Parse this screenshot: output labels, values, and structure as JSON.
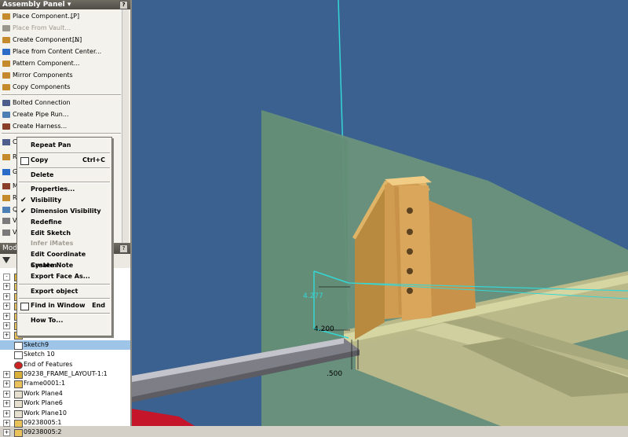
{
  "assembly_panel": {
    "title": "Assembly Panel ▾",
    "help": "?",
    "tools": [
      {
        "label": "Place Component...",
        "shortcut": "[P]",
        "icon": "place-component-icon",
        "enabled": true
      },
      {
        "label": "Place From Vault...",
        "shortcut": "",
        "icon": "place-from-vault-icon",
        "enabled": false
      },
      {
        "label": "Create Component...",
        "shortcut": "[N]",
        "icon": "create-component-icon",
        "enabled": true
      },
      {
        "label": "Place from Content Center...",
        "shortcut": "",
        "icon": "content-center-icon",
        "enabled": true
      },
      {
        "label": "Pattern Component...",
        "shortcut": "",
        "icon": "pattern-component-icon",
        "enabled": true
      },
      {
        "label": "Mirror Components",
        "shortcut": "",
        "icon": "mirror-components-icon",
        "enabled": true
      },
      {
        "label": "Copy Components",
        "shortcut": "",
        "icon": "copy-components-icon",
        "enabled": true
      },
      {
        "label": "Bolted Connection",
        "shortcut": "",
        "icon": "bolted-connection-icon",
        "enabled": true
      },
      {
        "label": "Create Pipe Run...",
        "shortcut": "",
        "icon": "pipe-run-icon",
        "enabled": true
      },
      {
        "label": "Create Harness...",
        "shortcut": "",
        "icon": "harness-icon",
        "enabled": true
      }
    ],
    "partial_items": [
      "C",
      "R",
      "G",
      "M",
      "R",
      "Q",
      "V",
      "V"
    ]
  },
  "model_browser": {
    "title": "Mod",
    "help": "?",
    "rows": [
      {
        "label": "",
        "icon": "assembly-icon",
        "expand": "-"
      },
      {
        "label": "",
        "icon": "folder-icon",
        "expand": "+"
      },
      {
        "label": "",
        "icon": "part-icon",
        "expand": "+"
      },
      {
        "label": "",
        "icon": "part-icon",
        "expand": "+"
      },
      {
        "label": "",
        "icon": "part-icon",
        "expand": "+"
      },
      {
        "label": "",
        "icon": "part-icon",
        "expand": "+"
      },
      {
        "label": "",
        "icon": "part-icon",
        "expand": "+"
      },
      {
        "label": "Sketch9",
        "icon": "sketch-icon",
        "expand": ""
      },
      {
        "label": "Sketch 10",
        "icon": "sketch-icon",
        "expand": ""
      },
      {
        "label": "End of Features",
        "icon": "end-of-features-icon",
        "expand": ""
      },
      {
        "label": "09238_FRAME_LAYOUT-1:1",
        "icon": "assembly-icon",
        "expand": "+"
      },
      {
        "label": "Frame0001:1",
        "icon": "part-icon",
        "expand": "+"
      },
      {
        "label": "Work Plane4",
        "icon": "work-plane-icon",
        "expand": "+"
      },
      {
        "label": "Work Plane6",
        "icon": "work-plane-icon",
        "expand": "+"
      },
      {
        "label": "Work Plane10",
        "icon": "work-plane-icon",
        "expand": "+"
      },
      {
        "label": "09238005:1",
        "icon": "part-icon",
        "expand": "+"
      },
      {
        "label": "09238005:2",
        "icon": "part-icon",
        "expand": "+"
      }
    ]
  },
  "context_menu": {
    "items": [
      {
        "label": "Repeat Pan",
        "shortcut": "",
        "checked": false,
        "icon": "",
        "enabled": true
      },
      {
        "sep": true
      },
      {
        "label": "Copy",
        "shortcut": "Ctrl+C",
        "checked": false,
        "icon": "copy-icon",
        "enabled": true
      },
      {
        "sep": true
      },
      {
        "label": "Delete",
        "shortcut": "",
        "checked": false,
        "icon": "",
        "enabled": true
      },
      {
        "sep": true
      },
      {
        "label": "Properties...",
        "shortcut": "",
        "checked": false,
        "icon": "",
        "enabled": true
      },
      {
        "label": "Visibility",
        "shortcut": "",
        "checked": true,
        "icon": "",
        "enabled": true
      },
      {
        "label": "Dimension Visibility",
        "shortcut": "",
        "checked": true,
        "icon": "",
        "enabled": true
      },
      {
        "label": "Redefine",
        "shortcut": "",
        "checked": false,
        "icon": "",
        "enabled": true
      },
      {
        "label": "Edit Sketch",
        "shortcut": "",
        "checked": false,
        "icon": "",
        "enabled": true
      },
      {
        "label": "Infer iMates",
        "shortcut": "",
        "checked": false,
        "icon": "",
        "enabled": false
      },
      {
        "label": "Edit Coordinate System",
        "shortcut": "",
        "checked": false,
        "icon": "",
        "enabled": true
      },
      {
        "label": "Create Note",
        "shortcut": "",
        "checked": false,
        "icon": "",
        "enabled": true
      },
      {
        "label": "Export Face As...",
        "shortcut": "",
        "checked": false,
        "icon": "",
        "enabled": true
      },
      {
        "sep": true
      },
      {
        "label": "Export object",
        "shortcut": "",
        "checked": false,
        "icon": "",
        "enabled": true
      },
      {
        "sep": true
      },
      {
        "label": "Find in Window",
        "shortcut": "End",
        "checked": false,
        "icon": "find-icon",
        "enabled": true
      },
      {
        "sep": true
      },
      {
        "label": "How To...",
        "shortcut": "",
        "checked": false,
        "icon": "",
        "enabled": true
      }
    ]
  },
  "viewport": {
    "background": "#3a6190",
    "dimensions": [
      "4.277",
      "4.200",
      ".500"
    ]
  },
  "colors": {
    "panel_bg": "#f4f2ec",
    "title_bar": "#5a5852",
    "viewport_bg": "#3a6190",
    "bracket": "#c99a4e",
    "plane": "#6d957b",
    "axis": "#35d6d6"
  }
}
